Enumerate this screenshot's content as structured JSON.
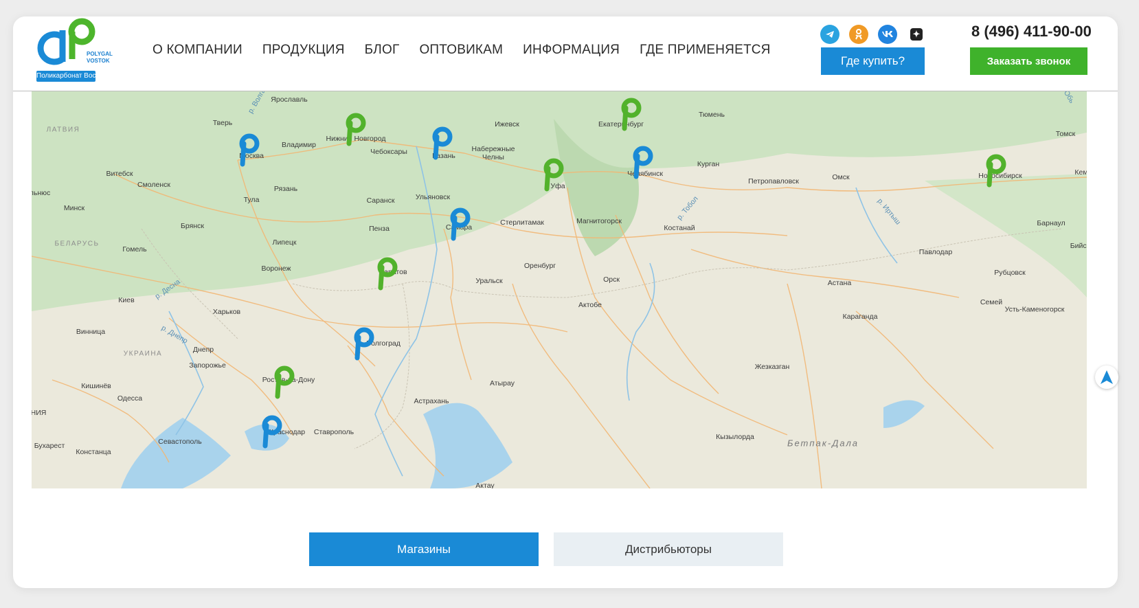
{
  "header": {
    "logo_text": "POLYGAL VOSTOK",
    "logo_badge": "Поликарбонат Восток",
    "nav": [
      "О КОМПАНИИ",
      "ПРОДУКЦИЯ",
      "БЛОГ",
      "ОПТОВИКАМ",
      "ИНФОРМАЦИЯ",
      "ГДЕ ПРИМЕНЯЕТСЯ"
    ],
    "socials": [
      "telegram-icon",
      "odnoklassniki-icon",
      "vk-icon",
      "yandex-zen-icon"
    ],
    "where_to_buy": "Где купить?",
    "phone": "8 (496) 411-90-00",
    "call_button": "Заказать звонок"
  },
  "map": {
    "cities": [
      "Ярославль",
      "Тверь",
      "Москва",
      "Владимир",
      "Нижний Новгород",
      "Чебоксары",
      "Казань",
      "Ижевск",
      "Набережные Челны",
      "Екатеринбург",
      "Тюмень",
      "Томск",
      "Витебск",
      "Смоленск",
      "Рязань",
      "Тула",
      "Саранск",
      "Ульяновск",
      "Уфа",
      "Челябинск",
      "Курган",
      "Петропавловск",
      "Омск",
      "Новосибирск",
      "Минск",
      "Брянск",
      "Пенза",
      "Самара",
      "Стерлитамак",
      "Магнитогорск",
      "Костанай",
      "Барнаул",
      "Гомель",
      "Липецк",
      "Воронеж",
      "Саратов",
      "Оренбург",
      "Павлодар",
      "Бийск",
      "Рубцовск",
      "Киев",
      "Харьков",
      "Уральск",
      "Орск",
      "Актобе",
      "Астана",
      "Семей",
      "Усть-Каменогорск",
      "Винница",
      "Днепр",
      "Запорожье",
      "Волгоград",
      "Караганда",
      "Ростов-на-Дону",
      "Кишинёв",
      "Атырау",
      "Жезказган",
      "Одесса",
      "Астрахань",
      "Краснодар",
      "Ставрополь",
      "Севастополь",
      "Кызылорда",
      "Бухарест",
      "Констанца",
      "Актау"
    ],
    "countries": [
      "ЛАТВИЯ",
      "БЕЛАРУСЬ",
      "УКРАИНА"
    ],
    "regions": [
      "Бетпак-Дала"
    ],
    "rivers": [
      "р. Волга",
      "р. Десна",
      "р. Днепр",
      "р. Тобол",
      "р. Иртыш",
      "Обь"
    ],
    "edge_labels": [
      "льнюс",
      "Кем",
      "НИЯ"
    ],
    "pin_colors": {
      "blue": "#1a8ad6",
      "green": "#52b22c"
    }
  },
  "tabs": {
    "shops": "Магазины",
    "distributors": "Дистрибьюторы"
  }
}
